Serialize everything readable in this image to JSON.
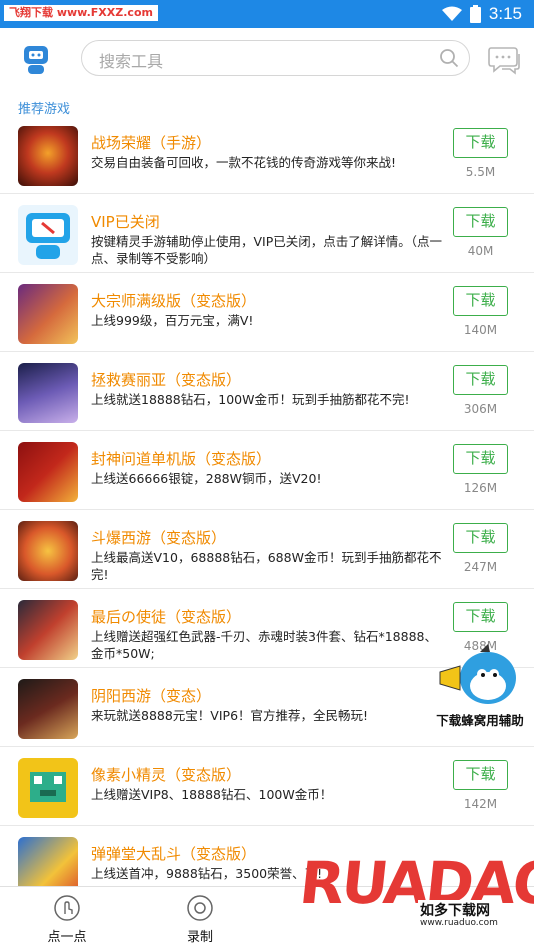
{
  "statusbar": {
    "watermark": "飞翔下载 www.FXXZ.com",
    "time": "3:15"
  },
  "header": {
    "search_placeholder": "搜索工具"
  },
  "section": {
    "title": "推荐游戏"
  },
  "items": [
    {
      "title": "战场荣耀（手游）",
      "desc": "交易自由装备可回收，一款不花钱的传奇游戏等你来战!",
      "button": "下载",
      "size": "5.5M"
    },
    {
      "title": "VIP已关闭",
      "desc": "按键精灵手游辅助停止使用，VIP已关闭，点击了解详情。（点一点、录制等不受影响）",
      "button": "下载",
      "size": "40M"
    },
    {
      "title": "大宗师满级版（变态版）",
      "desc": "上线999级，百万元宝，满V!",
      "button": "下载",
      "size": "140M"
    },
    {
      "title": "拯救赛丽亚（变态版）",
      "desc": "上线就送18888钻石，100W金币！玩到手抽筋都花不完!",
      "button": "下载",
      "size": "306M"
    },
    {
      "title": "封神问道单机版（变态版）",
      "desc": "上线送66666银锭，288W铜币，送V20!",
      "button": "下载",
      "size": "126M"
    },
    {
      "title": "斗爆西游（变态版）",
      "desc": "上线最高送V10，68888钻石，688W金币！玩到手抽筋都花不完!",
      "button": "下载",
      "size": "247M"
    },
    {
      "title": "最后の使徒（变态版）",
      "desc": "上线赠送超强红色武器-千刃、赤魂时装3件套、钻石*18888、金币*50W;",
      "button": "下载",
      "size": "488M"
    },
    {
      "title": "阴阳西游（变态）",
      "desc": "来玩就送8888元宝！VIP6！官方推荐，全民畅玩!",
      "button": "",
      "size": ""
    },
    {
      "title": "像素小精灵（变态版）",
      "desc": "上线赠送VIP8、18888钻石、100W金币！",
      "button": "下载",
      "size": "142M"
    },
    {
      "title": "弹弹堂大乱斗（变态版）",
      "desc": "上线送首冲，9888钻石，3500荣誉、币!",
      "button": "",
      "size": ""
    }
  ],
  "bottom_tabs": [
    {
      "label": "点一点"
    },
    {
      "label": "录制"
    }
  ],
  "overlays": {
    "mascot_caption": "下载蜂窝用辅助",
    "ruadao_logo": "RUADAO",
    "ruadao_cn": "如多下载网",
    "ruadao_url": "www.ruaduo.com"
  },
  "colors": {
    "statusbar": "#1e88e5",
    "accent_blue": "#3d8fd8",
    "title_orange": "#f08a00",
    "button_green": "#3cae4a",
    "logo_red": "#e53935"
  },
  "icons": {
    "header_left": "robot-icon",
    "search": "search-icon",
    "header_right": "chat-icon",
    "tab_1": "tap-icon",
    "tab_2": "record-icon"
  }
}
